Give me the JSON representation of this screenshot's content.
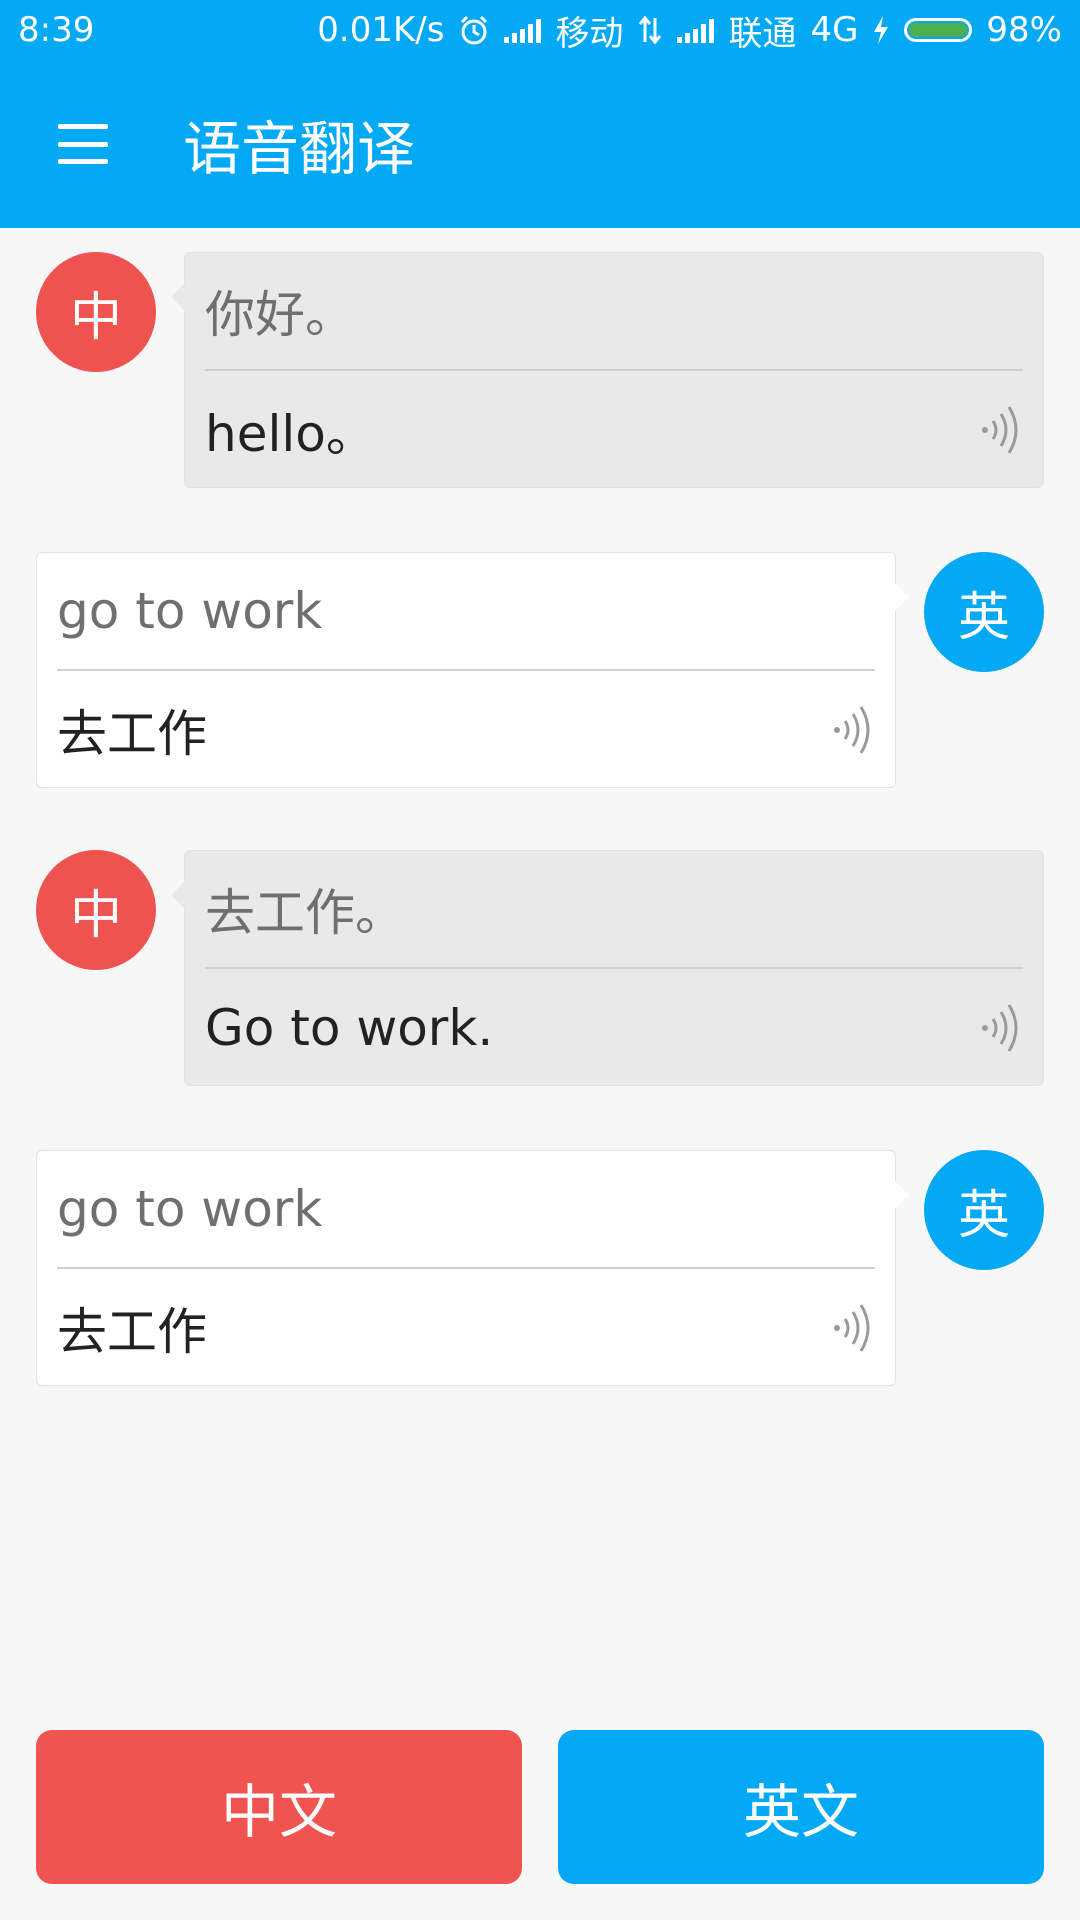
{
  "status_bar": {
    "time": "8:39",
    "speed": "0.01K/s",
    "carrier1": "移动",
    "carrier2": "联通",
    "network": "4G",
    "battery": "98%"
  },
  "app_bar": {
    "title": "语音翻译"
  },
  "messages": [
    {
      "lang": "zh",
      "avatar": "中",
      "source": "你好。",
      "translation": "hello。"
    },
    {
      "lang": "en",
      "avatar": "英",
      "source": "go to work",
      "translation": "去工作"
    },
    {
      "lang": "zh",
      "avatar": "中",
      "source": "去工作。",
      "translation": "Go to work."
    },
    {
      "lang": "en",
      "avatar": "英",
      "source": "go to work",
      "translation": "去工作"
    }
  ],
  "buttons": {
    "chinese": "中文",
    "english": "英文"
  },
  "colors": {
    "primary": "#03a9f4",
    "chinese": "#f05451",
    "background": "#f7f7f7"
  }
}
